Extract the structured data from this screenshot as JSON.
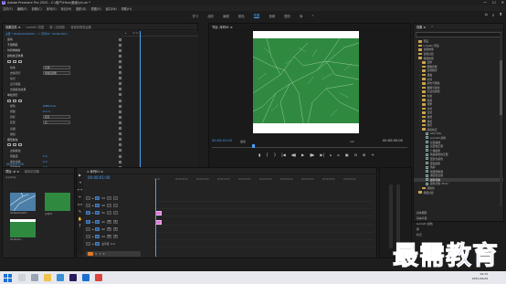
{
  "window": {
    "title": "Adobe Premiere Pro 2020 - C:\\用户\\Hive\\桌面\\yi\\um *",
    "controls": [
      "—",
      "☐",
      "✕"
    ]
  },
  "menu": [
    "文件(F)",
    "编辑(E)",
    "剪辑(C)",
    "序列(S)",
    "标记(M)",
    "图形(G)",
    "视图(V)",
    "窗口(W)",
    "帮助(H)"
  ],
  "workspaces": [
    "学习",
    "组件",
    "编辑",
    "颜色",
    "效果",
    "音频",
    "图形",
    "库"
  ],
  "workspace_active": "效果",
  "effects_panel": {
    "tabs": [
      "效果控件 ≡",
      "Lumetri 范围",
      "源: (无剪辑)",
      "音频剪辑混合器"
    ],
    "source_link": "主要 * 4b46e1fe3e67fe... ＞ 序列01 * 4b46e1fe3...",
    "ruler_ticks": [
      "▶",
      "00:00"
    ],
    "rows": [
      {
        "label": "运动",
        "kind": "head"
      },
      {
        "label": "不透明度",
        "kind": "head"
      },
      {
        "label": "时间重映射",
        "kind": "head"
      },
      {
        "label": "颜色校正效果",
        "kind": "head"
      },
      {
        "label": "shapes",
        "kind": "shapes"
      },
      {
        "label": "校准",
        "value": "亮调...",
        "kind": "select"
      },
      {
        "label": "去除流行",
        "value": "饱和度调整",
        "kind": "select"
      },
      {
        "label": "色光",
        "kind": "prop"
      },
      {
        "label": "显示蒙板",
        "kind": "prop"
      },
      {
        "label": "去除颜色效果",
        "kind": "prop"
      },
      {
        "label": "单色流行",
        "kind": "head"
      },
      {
        "label": "shapes2",
        "kind": "shapes"
      },
      {
        "label": "颜色",
        "value": "#8BCA1A",
        "kind": "value"
      },
      {
        "label": "视频",
        "value": "8.0 %",
        "kind": "value"
      },
      {
        "label": "目标",
        "value": "蓝色",
        "kind": "select"
      },
      {
        "label": "匹配",
        "value": "亮",
        "kind": "select"
      },
      {
        "label": "反相",
        "kind": "prop"
      },
      {
        "label": "阈值",
        "kind": "prop"
      },
      {
        "label": "图形颜色",
        "kind": "head"
      },
      {
        "label": "shapes3",
        "kind": "shapes"
      },
      {
        "label": "边缘颜色",
        "kind": "prop"
      },
      {
        "label": "容差度",
        "value": "0.0",
        "kind": "value"
      },
      {
        "label": "柔化边缘",
        "value": "0.0",
        "kind": "value"
      },
      {
        "label": "匹配颜色",
        "value": "0.0",
        "kind": "value"
      }
    ],
    "timecode": "00:00:01:00"
  },
  "monitor": {
    "tab": "节目: 序列01 ≡",
    "timecode_left": "00:00:01:00",
    "fit": "适合",
    "quality": "1/2",
    "timecode_right": "00:00:05:00",
    "transport": [
      "▮",
      "{",
      "}",
      "|◀",
      "◀▮",
      "▶",
      "▮▶",
      "▶|",
      "⌂",
      "⌂",
      "▣",
      "⊡",
      "⊞",
      "+"
    ]
  },
  "browser": {
    "tabs": [
      "效果 ≡",
      "»"
    ],
    "items": [
      {
        "label": "预设",
        "type": "folder",
        "indent": 0
      },
      {
        "label": "Lumetri 预设",
        "type": "folder",
        "indent": 0
      },
      {
        "label": "音频效果",
        "type": "folder",
        "indent": 0
      },
      {
        "label": "音频过渡",
        "type": "folder",
        "indent": 0
      },
      {
        "label": "视频效果",
        "type": "folder",
        "indent": 0
      },
      {
        "label": "变换",
        "type": "folder",
        "indent": 1
      },
      {
        "label": "图像控制",
        "type": "folder",
        "indent": 1
      },
      {
        "label": "实用程序",
        "type": "folder",
        "indent": 1
      },
      {
        "label": "扭曲",
        "type": "folder",
        "indent": 1
      },
      {
        "label": "时间",
        "type": "folder",
        "indent": 1
      },
      {
        "label": "杂色与颗粒",
        "type": "folder",
        "indent": 1
      },
      {
        "label": "模糊与锐化",
        "type": "folder",
        "indent": 1
      },
      {
        "label": "沉浸式视频",
        "type": "folder",
        "indent": 1
      },
      {
        "label": "生成",
        "type": "folder",
        "indent": 1
      },
      {
        "label": "视频",
        "type": "folder",
        "indent": 1
      },
      {
        "label": "调整",
        "type": "folder",
        "indent": 1
      },
      {
        "label": "过时",
        "type": "folder",
        "indent": 1
      },
      {
        "label": "过渡",
        "type": "folder",
        "indent": 1
      },
      {
        "label": "透视",
        "type": "folder",
        "indent": 1
      },
      {
        "label": "通道",
        "type": "folder",
        "indent": 1
      },
      {
        "label": "键控",
        "type": "folder",
        "indent": 1
      },
      {
        "label": "颜色校正",
        "type": "folder",
        "indent": 1
      },
      {
        "label": "ASC CDL",
        "type": "fx",
        "indent": 2
      },
      {
        "label": "Lumetri 颜色",
        "type": "fx",
        "indent": 2
      },
      {
        "label": "亮度曲线",
        "type": "fx",
        "indent": 2
      },
      {
        "label": "亮度校正器",
        "type": "fx",
        "indent": 2
      },
      {
        "label": "广播颜色",
        "type": "fx",
        "indent": 2
      },
      {
        "label": "快速颜色校正器",
        "type": "fx",
        "indent": 2
      },
      {
        "label": "更改为颜色",
        "type": "fx",
        "indent": 2
      },
      {
        "label": "更改颜色",
        "type": "fx",
        "indent": 2
      },
      {
        "label": "色彩",
        "type": "fx",
        "indent": 2
      },
      {
        "label": "视频限制器",
        "type": "fx",
        "indent": 2
      },
      {
        "label": "通道混合器",
        "type": "fx",
        "indent": 2
      },
      {
        "label": "颜色平衡",
        "type": "fx",
        "indent": 2
      },
      {
        "label": "颜色平衡 (HLS)",
        "type": "fx",
        "indent": 2
      },
      {
        "label": "风格化",
        "type": "folder",
        "indent": 1
      },
      {
        "label": "视频过渡",
        "type": "folder",
        "indent": 0
      }
    ],
    "selected": "颜色平衡",
    "bottom_items": [
      "基本图形",
      "基本声音",
      "Lumetri 颜色",
      "库",
      "标记"
    ]
  },
  "project": {
    "tabs": [
      "项目: yi ≡",
      "媒体浏览器"
    ],
    "path": "yi.prproj",
    "items": [
      {
        "label": "4b46e1fe3e67...",
        "duration": "5:00"
      },
      {
        "label": "序列01",
        "duration": "5:00"
      },
      {
        "label": "4b46e1fe...",
        "duration": ""
      }
    ]
  },
  "timeline": {
    "tab": "× 序列01 ≡",
    "timecode": "00:00:01:00",
    "ruler": [
      "00:00",
      "00:00:05:00",
      "00:00:10:00",
      "00:00:15:00",
      "00:00:20:00",
      "00:00:25:00",
      "00:00:30:00",
      "00:00:35:00",
      "00:00:40:00",
      "00:00:45:00"
    ],
    "tracks": [
      {
        "name": "V3",
        "kind": "video"
      },
      {
        "name": "V2",
        "kind": "video"
      },
      {
        "name": "V1",
        "kind": "video",
        "clip": true
      },
      {
        "name": "A1",
        "kind": "audio",
        "clip": true
      },
      {
        "name": "A2",
        "kind": "audio"
      },
      {
        "name": "A3",
        "kind": "audio"
      },
      {
        "name": "主声道",
        "kind": "master",
        "value": "0.0"
      }
    ],
    "tools": [
      "▶",
      "⇥",
      "⟷",
      "✂",
      "⟺",
      "✎",
      "✋",
      "T"
    ]
  },
  "taskbar": {
    "time": "19:13",
    "date": "2021/10/29"
  },
  "watermark": "最需教育"
}
